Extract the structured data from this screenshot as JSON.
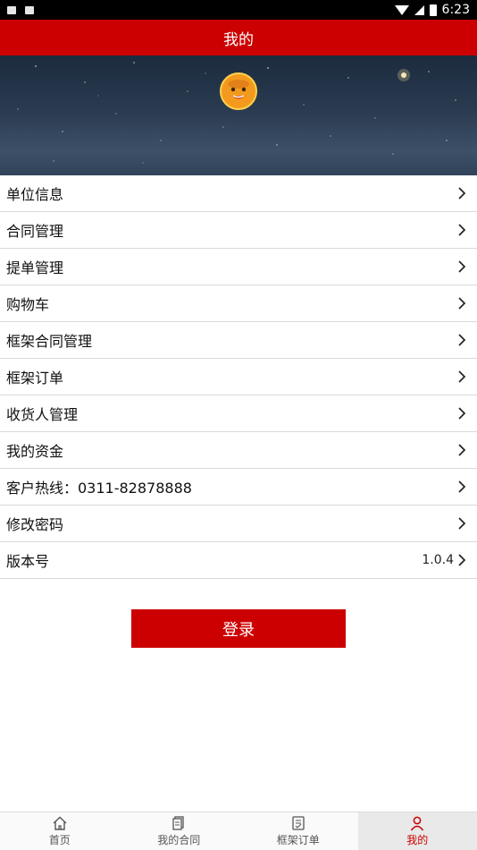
{
  "status_bar": {
    "time": "6:23"
  },
  "header": {
    "title": "我的"
  },
  "menu": {
    "items": [
      {
        "label": "单位信息",
        "value": ""
      },
      {
        "label": "合同管理",
        "value": ""
      },
      {
        "label": "提单管理",
        "value": ""
      },
      {
        "label": "购物车",
        "value": ""
      },
      {
        "label": "框架合同管理",
        "value": ""
      },
      {
        "label": "框架订单",
        "value": ""
      },
      {
        "label": "收货人管理",
        "value": ""
      },
      {
        "label": "我的资金",
        "value": ""
      },
      {
        "label": "客户热线：0311-82878888",
        "value": ""
      },
      {
        "label": "修改密码",
        "value": ""
      },
      {
        "label": "版本号",
        "value": "1.0.4"
      }
    ]
  },
  "login_label": "登录",
  "tabs": [
    {
      "label": "首页",
      "icon": "home-icon"
    },
    {
      "label": "我的合同",
      "icon": "contract-icon"
    },
    {
      "label": "框架订单",
      "icon": "order-icon"
    },
    {
      "label": "我的",
      "icon": "user-icon",
      "active": true
    }
  ],
  "colors": {
    "accent": "#cc0000",
    "status_bar": "#000000",
    "divider": "#d9d9d9"
  }
}
